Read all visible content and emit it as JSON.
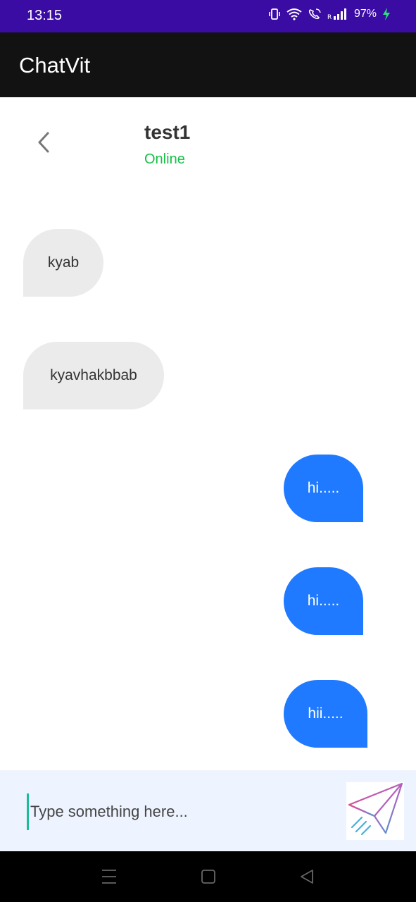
{
  "status_bar": {
    "time": "13:15",
    "battery": "97%",
    "background": "#3a0ca3"
  },
  "app_bar": {
    "title": "ChatVit"
  },
  "chat_header": {
    "contact_name": "test1",
    "contact_status": "Online",
    "status_color": "#16c047"
  },
  "messages": [
    {
      "text": "kyab",
      "direction": "received"
    },
    {
      "text": "kyavhakbbab",
      "direction": "received"
    },
    {
      "text": "hi.....",
      "direction": "sent"
    },
    {
      "text": "hi.....",
      "direction": "sent"
    },
    {
      "text": "hii.....",
      "direction": "sent"
    }
  ],
  "composer": {
    "placeholder": "Type something here...",
    "value": ""
  },
  "colors": {
    "sent_bubble": "#1f7aff",
    "received_bubble": "#ebebeb",
    "composer_bg": "#eef4ff"
  },
  "icons": {
    "back": "chevron-left-icon",
    "send": "paper-plane-icon",
    "nav_recents": "menu-lines-icon",
    "nav_home": "square-icon",
    "nav_back": "triangle-back-icon"
  }
}
